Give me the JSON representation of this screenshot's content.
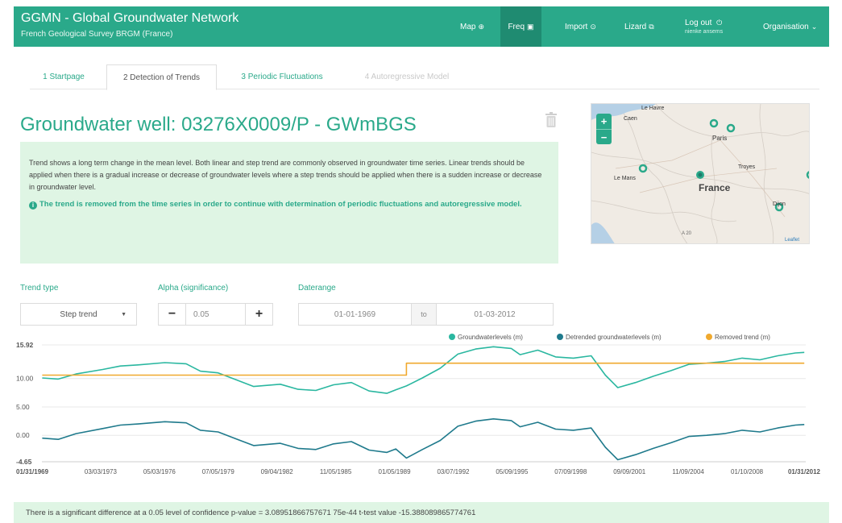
{
  "navbar": {
    "title": "GGMN - Global Groundwater Network",
    "subtitle": "French Geological Survey BRGM (France)",
    "items": [
      {
        "label": "Map",
        "icon": "globe-icon",
        "glyph": "⊕",
        "active": false
      },
      {
        "label": "Freq",
        "icon": "inbox-icon",
        "glyph": "▣",
        "active": true
      },
      {
        "label": "Import",
        "icon": "import-icon",
        "glyph": "⊙",
        "active": false
      },
      {
        "label": "Lizard",
        "icon": "external-link-icon",
        "glyph": "⧉",
        "active": false
      }
    ],
    "logout": {
      "label": "Log out",
      "glyph": "⏻",
      "user": "nienke ansems"
    },
    "organisation": {
      "label": "Organisation",
      "glyph": "⌄"
    }
  },
  "tabs": [
    {
      "label": "1 Startpage",
      "state": "link"
    },
    {
      "label": "2 Detection of Trends",
      "state": "active"
    },
    {
      "label": "3 Periodic Fluctuations",
      "state": "link"
    },
    {
      "label": "4 Autoregressive Model",
      "state": "disabled"
    }
  ],
  "page": {
    "title": "Groundwater well: 03276X0009/P - GWmBGS"
  },
  "info": {
    "text": "Trend shows a long term change in the mean level. Both linear and step trend are commonly observed in groundwater time series. Linear trends should be applied when there is a gradual increase or decrease of groundwater levels where a step trends should be applied when there is a sudden increase or decrease in groundwater level.",
    "note_icon": "i",
    "note": "The trend is removed from the time series in order to continue with determination of periodic fluctuations and autoregressive model."
  },
  "map": {
    "places": [
      "Le Havre",
      "Caen",
      "Paris",
      "Le Mans",
      "Troyes",
      "France",
      "Dijon"
    ],
    "scale": "A 20",
    "attribution": "Leaflet",
    "zoom_in": "+",
    "zoom_out": "−"
  },
  "filters": {
    "trend_type": {
      "label": "Trend type",
      "value": "Step trend",
      "caret": "▼"
    },
    "alpha": {
      "label": "Alpha (significance)",
      "value": "0.05",
      "minus": "−",
      "plus": "+"
    },
    "daterange": {
      "label": "Daterange",
      "from": "01-01-1969",
      "to_label": "to",
      "to": "01-03-2012"
    }
  },
  "result": {
    "text": "There is a significant difference at a 0.05 level of confidence p-value = 3.08951866757671 75e-44 t-test value -15.388089865774761"
  },
  "chart_data": {
    "type": "line",
    "legend": [
      "Groundwaterlevels (m)",
      "Detrended groundwaterlevels (m)",
      "Removed trend (m)"
    ],
    "legend_placement": "top-right",
    "colors": [
      "#2ab7a0",
      "#1f7a8c",
      "#f0a92e"
    ],
    "ylim": [
      -4.65,
      15.92
    ],
    "yticks": [
      "15.92",
      "10.00",
      "5.00",
      "0.00",
      "-4.65"
    ],
    "xlim": [
      1969.08,
      2012.08
    ],
    "xticks": [
      "01/31/1969",
      "03/03/1973",
      "05/03/1976",
      "07/05/1979",
      "09/04/1982",
      "11/05/1985",
      "01/05/1989",
      "03/07/1992",
      "05/09/1995",
      "07/09/1998",
      "09/09/2001",
      "11/09/2004",
      "01/10/2008",
      "01/31/2012"
    ],
    "series": [
      {
        "name": "Groundwaterlevels (m)",
        "x": [
          1969.1,
          1970.0,
          1971.0,
          1972.5,
          1973.5,
          1974.5,
          1976.0,
          1977.2,
          1978.0,
          1979.0,
          1980.0,
          1981.0,
          1982.5,
          1983.5,
          1984.5,
          1985.5,
          1986.5,
          1987.5,
          1988.5,
          1989.0,
          1989.6,
          1990.5,
          1991.5,
          1992.5,
          1993.5,
          1994.5,
          1995.5,
          1996.0,
          1997.0,
          1998.0,
          1999.0,
          2000.0,
          2000.8,
          2001.5,
          2002.5,
          2003.5,
          2004.5,
          2005.5,
          2006.5,
          2007.5,
          2008.5,
          2009.5,
          2010.5,
          2011.5,
          2012.0
        ],
        "values": [
          10.1,
          9.9,
          10.8,
          11.6,
          12.2,
          12.4,
          12.8,
          12.6,
          11.3,
          11.0,
          9.8,
          8.6,
          9.0,
          8.1,
          7.9,
          8.9,
          9.3,
          7.8,
          7.4,
          8.0,
          8.7,
          10.1,
          11.8,
          14.3,
          15.2,
          15.6,
          15.3,
          14.2,
          15.0,
          13.8,
          13.6,
          14.0,
          10.6,
          8.4,
          9.3,
          10.4,
          11.4,
          12.5,
          12.7,
          13.0,
          13.6,
          13.3,
          14.0,
          14.5,
          14.6
        ]
      },
      {
        "name": "Detrended groundwaterlevels (m)",
        "x": [
          1969.1,
          1970.0,
          1971.0,
          1972.5,
          1973.5,
          1974.5,
          1976.0,
          1977.2,
          1978.0,
          1979.0,
          1980.0,
          1981.0,
          1982.5,
          1983.5,
          1984.5,
          1985.5,
          1986.5,
          1987.5,
          1988.5,
          1989.0,
          1989.6,
          1990.5,
          1991.5,
          1992.5,
          1993.5,
          1994.5,
          1995.5,
          1996.0,
          1997.0,
          1998.0,
          1999.0,
          2000.0,
          2000.8,
          2001.5,
          2002.5,
          2003.5,
          2004.5,
          2005.5,
          2006.5,
          2007.5,
          2008.5,
          2009.5,
          2010.5,
          2011.5,
          2012.0
        ],
        "values": [
          -0.5,
          -0.7,
          0.3,
          1.2,
          1.8,
          2.0,
          2.4,
          2.2,
          0.9,
          0.6,
          -0.6,
          -1.8,
          -1.4,
          -2.3,
          -2.5,
          -1.5,
          -1.1,
          -2.6,
          -3.0,
          -2.4,
          -4.0,
          -2.5,
          -0.9,
          1.6,
          2.5,
          2.9,
          2.6,
          1.5,
          2.3,
          1.1,
          0.9,
          1.3,
          -2.1,
          -4.3,
          -3.4,
          -2.3,
          -1.3,
          -0.2,
          0.0,
          0.3,
          0.9,
          0.6,
          1.3,
          1.8,
          1.9
        ]
      },
      {
        "name": "Removed trend (m)",
        "x": [
          1969.1,
          1989.6,
          1989.6,
          2012.0
        ],
        "values": [
          10.6,
          10.6,
          12.7,
          12.7
        ]
      }
    ]
  }
}
